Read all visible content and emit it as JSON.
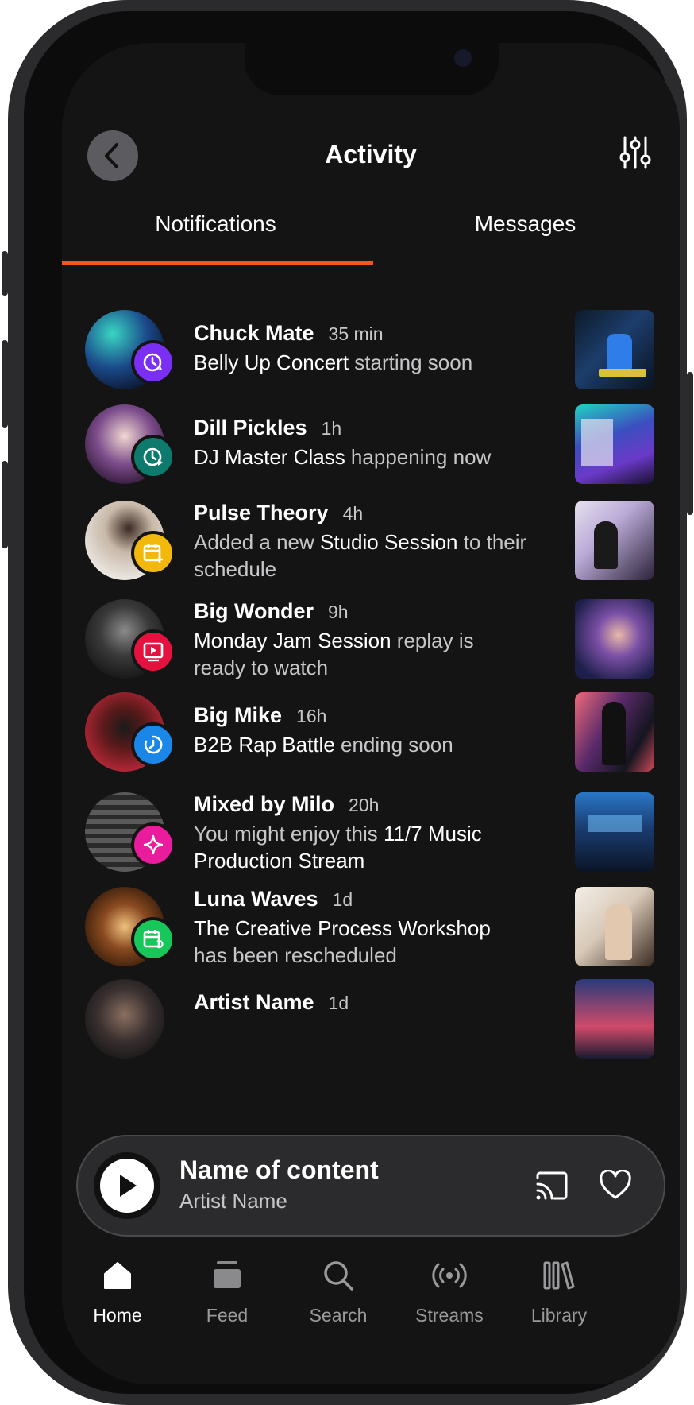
{
  "header": {
    "title": "Activity",
    "back_icon": "chevron-left-icon",
    "filter_icon": "sliders-icon"
  },
  "tabs": [
    {
      "label": "Notifications",
      "active": true
    },
    {
      "label": "Messages",
      "active": false
    }
  ],
  "notifications": [
    {
      "name": "Chuck Mate",
      "time": "35 min",
      "parts": [
        {
          "t": "Belly Up Concert",
          "h": true
        },
        {
          "t": " starting soon",
          "h": false
        }
      ],
      "badge_color": "#7b2ff2",
      "badge_icon": "clock-alert-icon"
    },
    {
      "name": "Dill Pickles",
      "time": "1h",
      "parts": [
        {
          "t": "DJ Master Class",
          "h": true
        },
        {
          "t": " happening now",
          "h": false
        }
      ],
      "badge_color": "#0e7a6e",
      "badge_icon": "clock-play-icon"
    },
    {
      "name": "Pulse Theory",
      "time": "4h",
      "parts": [
        {
          "t": "Added a new ",
          "h": false
        },
        {
          "t": "Studio Session",
          "h": true
        },
        {
          "t": " to their schedule",
          "h": false
        }
      ],
      "badge_color": "#f2b90c",
      "badge_icon": "calendar-plus-icon"
    },
    {
      "name": "Big Wonder",
      "time": "9h",
      "parts": [
        {
          "t": "Monday Jam Session",
          "h": true
        },
        {
          "t": " replay is ready to watch",
          "h": false
        }
      ],
      "badge_color": "#e5113f",
      "badge_icon": "play-screen-icon"
    },
    {
      "name": "Big Mike",
      "time": "16h",
      "parts": [
        {
          "t": "B2B Rap Battle",
          "h": true
        },
        {
          "t": " ending soon",
          "h": false
        }
      ],
      "badge_color": "#1a86e8",
      "badge_icon": "timer-icon"
    },
    {
      "name": "Mixed by Milo",
      "time": "20h",
      "parts": [
        {
          "t": "You might enjoy this ",
          "h": false
        },
        {
          "t": "11/7 Music Production Stream",
          "h": true
        }
      ],
      "badge_color": "#e81c9c",
      "badge_icon": "sparkle-icon"
    },
    {
      "name": "Luna Waves",
      "time": "1d",
      "parts": [
        {
          "t": "The Creative Process Workshop",
          "h": true
        },
        {
          "t": " has been rescheduled",
          "h": false
        }
      ],
      "badge_color": "#18c75a",
      "badge_icon": "calendar-refresh-icon"
    },
    {
      "name": "Artist Name",
      "time": "1d",
      "parts": [],
      "badge_color": "#555555",
      "badge_icon": "none"
    }
  ],
  "player": {
    "title": "Name of content",
    "subtitle": "Artist Name",
    "play_icon": "play-icon",
    "cast_icon": "cast-icon",
    "favorite_icon": "heart-icon"
  },
  "nav": [
    {
      "label": "Home",
      "icon": "home-icon",
      "active": true
    },
    {
      "label": "Feed",
      "icon": "feed-icon",
      "active": false
    },
    {
      "label": "Search",
      "icon": "search-icon",
      "active": false
    },
    {
      "label": "Streams",
      "icon": "broadcast-icon",
      "active": false
    },
    {
      "label": "Library",
      "icon": "library-icon",
      "active": false
    }
  ],
  "colors": {
    "accent": "#f05a14",
    "background": "#141415",
    "inactive_nav": "#9a9a9d"
  }
}
